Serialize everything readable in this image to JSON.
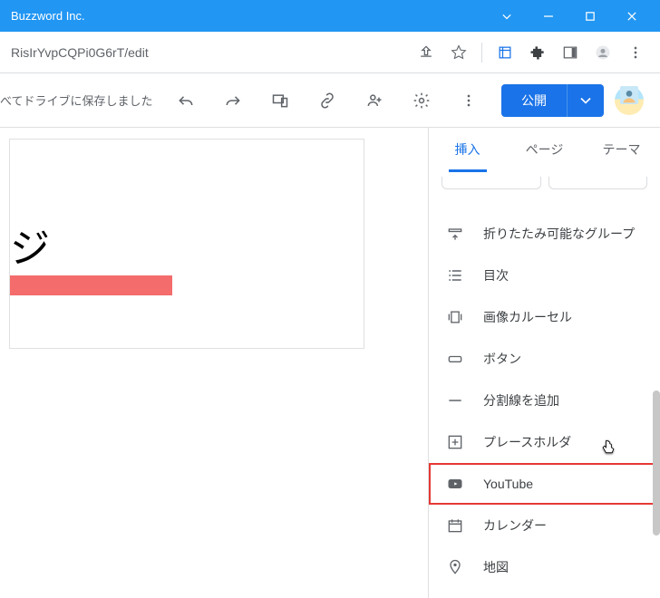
{
  "window": {
    "title": "Buzzword Inc."
  },
  "address_bar": {
    "url_suffix": "RisIrYvpCQPi0G6rT/edit"
  },
  "toolbar": {
    "save_status": "べてドライブに保存しました",
    "publish_label": "公開"
  },
  "editor": {
    "page_heading": "ジ"
  },
  "side": {
    "tabs": [
      "挿入",
      "ページ",
      "テーマ"
    ],
    "active_tab_index": 0,
    "insert_items": [
      {
        "id": "collapsible-group",
        "label": "折りたたみ可能なグループ",
        "icon": "collapse"
      },
      {
        "id": "toc",
        "label": "目次",
        "icon": "toc"
      },
      {
        "id": "image-carousel",
        "label": "画像カルーセル",
        "icon": "carousel"
      },
      {
        "id": "button",
        "label": "ボタン",
        "icon": "button"
      },
      {
        "id": "divider",
        "label": "分割線を追加",
        "icon": "divider"
      },
      {
        "id": "placeholder",
        "label": "プレースホルダ",
        "icon": "placeholder"
      },
      {
        "id": "youtube",
        "label": "YouTube",
        "icon": "youtube",
        "highlighted": true
      },
      {
        "id": "calendar",
        "label": "カレンダー",
        "icon": "calendar"
      },
      {
        "id": "map",
        "label": "地図",
        "icon": "map"
      }
    ]
  }
}
